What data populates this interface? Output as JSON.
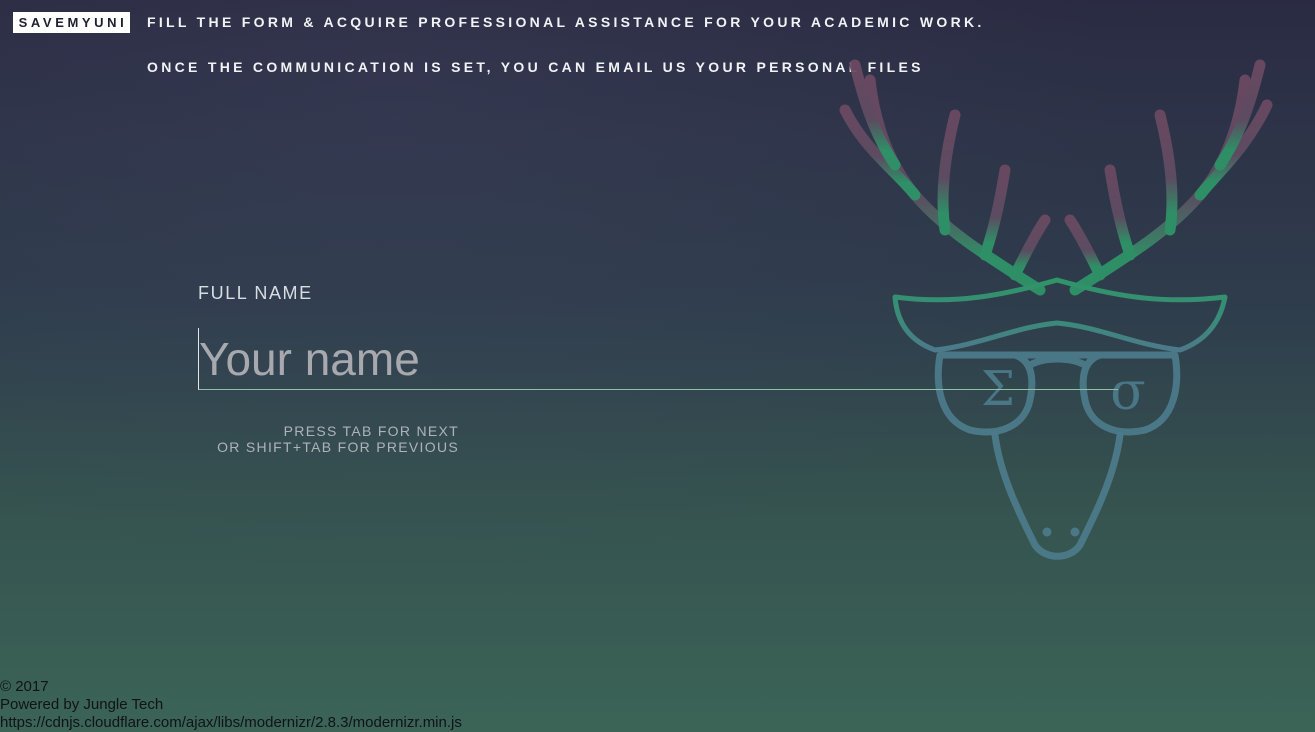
{
  "header": {
    "logo": "SAVEMYUNI",
    "tagline_line1": "FILL THE FORM & ACQUIRE PROFESSIONAL ASSISTANCE FOR YOUR ACADEMIC WORK.",
    "tagline_line2": "ONCE THE COMMUNICATION IS SET, YOU CAN EMAIL US YOUR PERSONAL FILES"
  },
  "form": {
    "label": "FULL NAME",
    "input_value": "",
    "placeholder": "Your name",
    "hint_line1": "PRESS TAB FOR NEXT",
    "hint_line2": "OR SHIFT+TAB FOR PREVIOUS"
  },
  "illustration": {
    "name": "deer-with-glasses-icon",
    "left_lens_glyph": "Σ",
    "right_lens_glyph": "σ",
    "colors": {
      "antlers": "#6b4a62",
      "crown": "#2f9468",
      "face": "#4c7a8a"
    }
  },
  "footer": {
    "copyright": "© 2017",
    "powered": "Powered by Jungle Tech",
    "script_url": "https://cdnjs.cloudflare.com/ajax/libs/modernizr/2.8.3/modernizr.min.js"
  }
}
